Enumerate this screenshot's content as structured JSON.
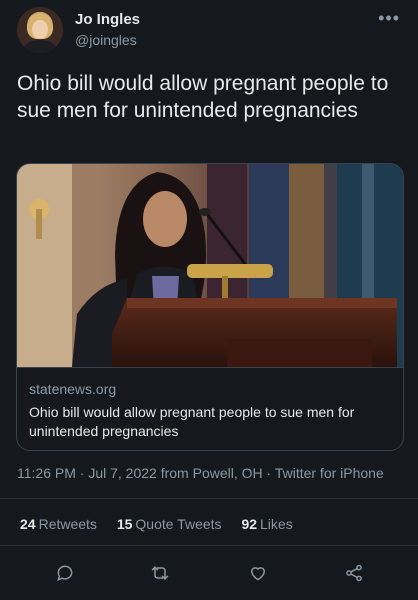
{
  "author": {
    "name": "Jo Ingles",
    "handle": "@joingles"
  },
  "tweet": {
    "text": "Ohio bill would allow pregnant people to sue men for unintended pregnancies"
  },
  "card": {
    "domain": "statenews.org",
    "title": "Ohio bill would allow pregnant people to sue men for unintended pregnancies"
  },
  "meta": {
    "timestamp": "11:26 PM · Jul 7, 2022 from Powell, OH · ",
    "source": "Twitter for iPhone"
  },
  "stats": {
    "retweets_count": "24",
    "retweets_label": "Retweets",
    "quotes_count": "15",
    "quotes_label": "Quote Tweets",
    "likes_count": "92",
    "likes_label": "Likes"
  },
  "icons": {
    "more": "more-icon",
    "reply": "reply-icon",
    "retweet": "retweet-icon",
    "like": "heart-icon",
    "share": "share-icon"
  },
  "colors": {
    "background": "#15181c",
    "text": "#e7e9ea",
    "secondary": "#8b98a5",
    "border": "#38444d"
  }
}
